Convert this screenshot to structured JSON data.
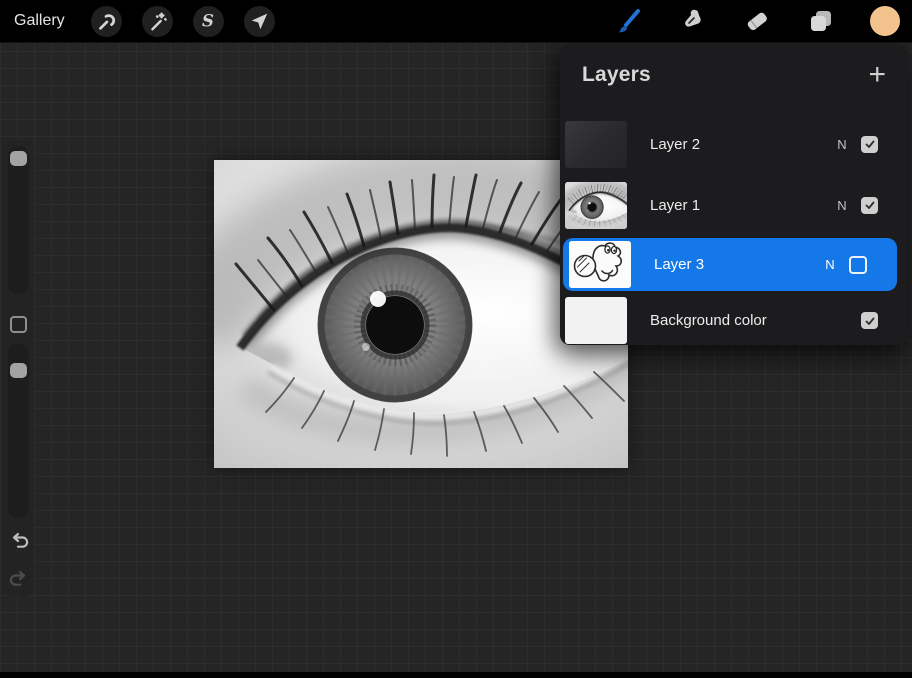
{
  "toolbar": {
    "gallery_label": "Gallery",
    "selection_glyph": "S",
    "left_tools": [
      "actions-wrench",
      "adjustments-wand",
      "selection-s",
      "transform-arrow"
    ],
    "right_tools": [
      "paint-brush",
      "smudge-finger",
      "eraser",
      "layers-stack",
      "color-swatch"
    ],
    "active_tool": "paint-brush"
  },
  "layers_panel": {
    "title": "Layers",
    "add_label": "+",
    "layers": [
      {
        "name": "Layer 2",
        "blend": "N",
        "visible": true,
        "selected": false,
        "thumb": "dark-paint"
      },
      {
        "name": "Layer 1",
        "blend": "N",
        "visible": true,
        "selected": false,
        "thumb": "eye-photo"
      },
      {
        "name": "Layer 3",
        "blend": "N",
        "visible": false,
        "selected": true,
        "thumb": "character-sketch"
      },
      {
        "name": "Background color",
        "blend": "",
        "visible": true,
        "selected": false,
        "thumb": "white"
      }
    ]
  },
  "sidebar": {
    "sliders": [
      "brush-size",
      "brush-opacity"
    ],
    "buttons": [
      "modify",
      "undo",
      "redo"
    ]
  },
  "canvas": {
    "content": "grayscale-eye-photo"
  },
  "colors": {
    "selected_row_blue": "#1478e8",
    "brush_active_blue": "#2273d8",
    "color_swatch": "#f2c38c",
    "panel_bg": "#1c1c1e",
    "workspace_bg": "#252525",
    "toolbar_bg": "#000000"
  }
}
